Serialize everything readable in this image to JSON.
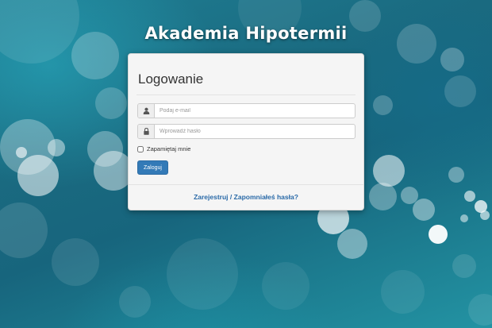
{
  "site": {
    "title": "Akademia Hipotermii"
  },
  "login": {
    "title": "Logowanie",
    "email": {
      "placeholder": "Podaj e-mail",
      "value": "",
      "icon": "user-icon"
    },
    "password": {
      "placeholder": "Wprowadź hasło",
      "value": "",
      "icon": "lock-icon"
    },
    "remember_label": "Zapamiętaj mnie",
    "remember_checked": false,
    "submit_label": "Zaloguj"
  },
  "footer": {
    "register_label": "Zarejestruj",
    "separator": "/",
    "forgot_label": "Zapomniałeś hasła?"
  },
  "colors": {
    "accent": "#337ab7",
    "background": "#17657d",
    "panel": "#f5f5f5"
  }
}
